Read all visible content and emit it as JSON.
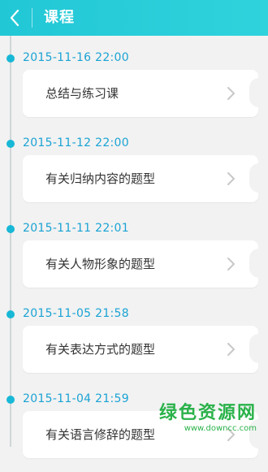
{
  "header": {
    "title": "课程",
    "back_icon": "chevron-left-icon",
    "background": "#28cbd8"
  },
  "timeline": {
    "dot_color": "#18b8d6",
    "date_color": "#1aa3d4",
    "entries": [
      {
        "date": "2015-11-16 22:00",
        "title": "总结与练习课"
      },
      {
        "date": "2015-11-12 22:00",
        "title": "有关归纳内容的题型"
      },
      {
        "date": "2015-11-11 22:01",
        "title": "有关人物形象的题型"
      },
      {
        "date": "2015-11-05 21:58",
        "title": "有关表达方式的题型"
      },
      {
        "date": "2015-11-04 21:59",
        "title": "有关语言修辞的题型"
      }
    ]
  },
  "watermark": {
    "logo_text": "绿色资源网",
    "url": "www.downcc.com"
  }
}
